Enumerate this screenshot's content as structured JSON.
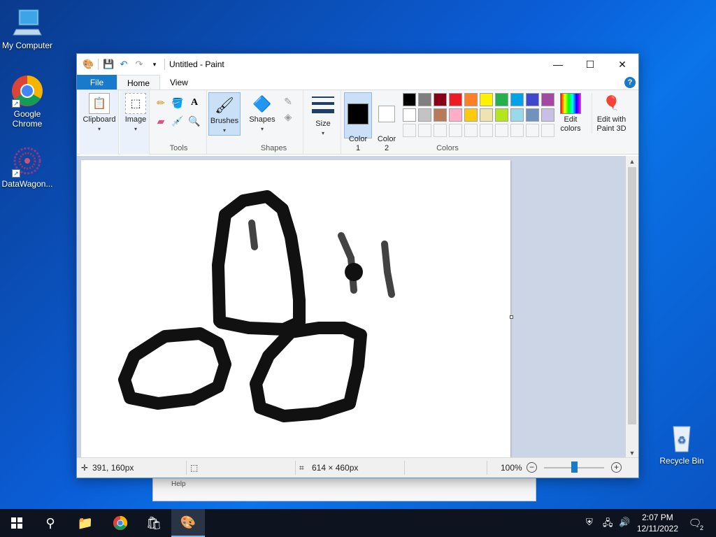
{
  "desktop": {
    "icons": [
      {
        "label": "My Computer"
      },
      {
        "label": "Google Chrome"
      },
      {
        "label": "DataWagon..."
      },
      {
        "label": "Recycle Bin"
      }
    ]
  },
  "background_window": {
    "help_label": "Help"
  },
  "paint": {
    "title": "Untitled - Paint",
    "tabs": {
      "file": "File",
      "home": "Home",
      "view": "View"
    },
    "groups": {
      "clipboard": "Clipboard",
      "image": "Image",
      "tools": "Tools",
      "brushes": "Brushes",
      "shapes_btn": "Shapes",
      "shapes": "Shapes",
      "size": "Size",
      "color1": "Color\n1",
      "color2": "Color\n2",
      "colors": "Colors",
      "edit_colors": "Edit colors",
      "edit_paint3d": "Edit with Paint 3D"
    },
    "palette_row1": [
      "#000000",
      "#7f7f7f",
      "#880015",
      "#ed1c24",
      "#ff7f27",
      "#fff200",
      "#22b14c",
      "#00a2e8",
      "#3f48cc",
      "#a349a4"
    ],
    "palette_row2": [
      "#ffffff",
      "#c3c3c3",
      "#b97a57",
      "#ffaec9",
      "#ffc90e",
      "#efe4b0",
      "#b5e61d",
      "#99d9ea",
      "#7092be",
      "#c8bfe7"
    ],
    "color1": "#000000",
    "color2": "#ffffff",
    "status": {
      "cursor_pos": "391, 160px",
      "canvas_size": "614 × 460px",
      "zoom": "100%"
    }
  },
  "taskbar": {
    "time": "2:07 PM",
    "date": "12/11/2022",
    "notifications": "2"
  }
}
